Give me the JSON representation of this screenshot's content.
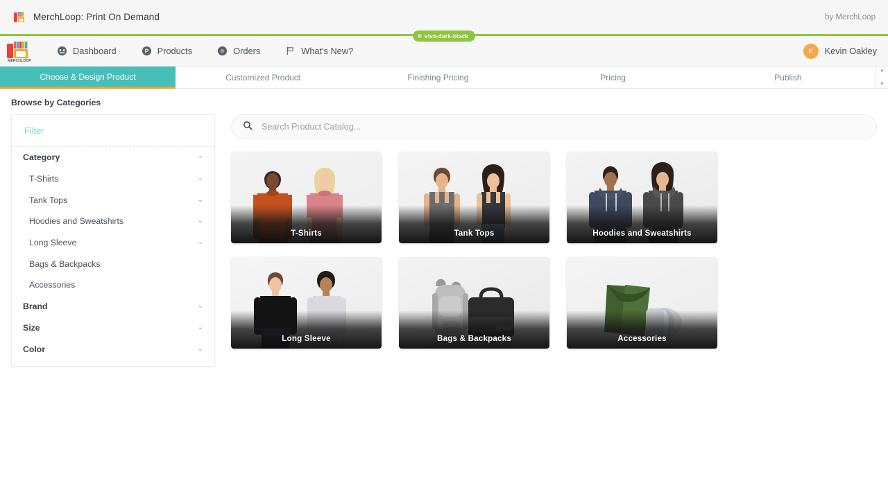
{
  "titlebar": {
    "app_title": "MerchLoop: Print On Demand",
    "by_line": "by MerchLoop",
    "logo_icon": "merchloop-store-icon"
  },
  "navbar": {
    "brand_logo": "merchloop-logo",
    "brand_text": "MERCHLOOP",
    "items": [
      {
        "label": "Dashboard",
        "icon": "dashboard-gauge-icon"
      },
      {
        "label": "Products",
        "icon": "products-circle-p-icon"
      },
      {
        "label": "Orders",
        "icon": "orders-gear-icon"
      },
      {
        "label": "What's New?",
        "icon": "flag-icon"
      }
    ],
    "theme_badge": {
      "label": "viva-dark-black",
      "color": "#8cc63e"
    },
    "user": {
      "initial": "K",
      "name": "Kevin Oakley",
      "avatar_color": "#f7a94a"
    }
  },
  "steps": {
    "items": [
      {
        "label": "Choose & Design Product",
        "active": true
      },
      {
        "label": "Customized Product",
        "active": false
      },
      {
        "label": "Finishing Pricing",
        "active": false
      },
      {
        "label": "Pricing",
        "active": false
      },
      {
        "label": "Publish",
        "active": false
      }
    ],
    "active_bg": "#46bfbb",
    "active_underline": "#f5a623",
    "scroll_up_icon": "caret-up-icon",
    "scroll_down_icon": "caret-down-icon"
  },
  "page": {
    "browse_title": "Browse by Categories"
  },
  "filter_panel": {
    "filter_placeholder": "Filter",
    "filter_value": "",
    "groups": [
      {
        "label": "Category",
        "expanded": true,
        "chevron": "chevron-up-icon",
        "children": [
          {
            "label": "T-Shirts",
            "chevron": "chevron-down-icon"
          },
          {
            "label": "Tank Tops",
            "chevron": "chevron-down-icon"
          },
          {
            "label": "Hoodies and Sweatshirts",
            "chevron": "chevron-down-icon"
          },
          {
            "label": "Long Sleeve",
            "chevron": "chevron-down-icon"
          },
          {
            "label": "Bags & Backpacks",
            "chevron": ""
          },
          {
            "label": "Accessories",
            "chevron": ""
          }
        ]
      },
      {
        "label": "Brand",
        "expanded": false,
        "chevron": "chevron-down-icon",
        "children": []
      },
      {
        "label": "Size",
        "expanded": false,
        "chevron": "chevron-down-icon",
        "children": []
      },
      {
        "label": "Color",
        "expanded": false,
        "chevron": "chevron-down-icon",
        "children": []
      }
    ]
  },
  "catalog": {
    "search_placeholder": "Search Product Catalog...",
    "search_value": "",
    "search_icon": "search-icon",
    "cards": [
      {
        "label": "T-Shirts"
      },
      {
        "label": "Tank Tops"
      },
      {
        "label": "Hoodies and Sweatshirts"
      },
      {
        "label": "Long Sleeve"
      },
      {
        "label": "Bags & Backpacks"
      },
      {
        "label": "Accessories"
      }
    ]
  }
}
